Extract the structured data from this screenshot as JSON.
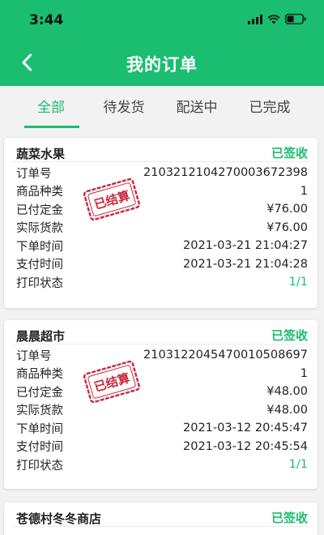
{
  "status_bar": {
    "time": "3:44"
  },
  "header": {
    "title": "我的订单"
  },
  "tabs": [
    {
      "label": "全部",
      "active": true
    },
    {
      "label": "待发货",
      "active": false
    },
    {
      "label": "配送中",
      "active": false
    },
    {
      "label": "已完成",
      "active": false
    }
  ],
  "colors": {
    "accent": "#1bbd71",
    "stamp": "#c8283e"
  },
  "orders": [
    {
      "store": "蔬菜水果",
      "status": "已签收",
      "stamp": "已结算",
      "rows": [
        {
          "label": "订单号",
          "value": "21032121042700036723​98"
        },
        {
          "label": "商品种类",
          "value": "1"
        },
        {
          "label": "已付定金",
          "value": "¥76.00"
        },
        {
          "label": "实际货款",
          "value": "¥76.00"
        },
        {
          "label": "下单时间",
          "value": "2021-03-21 21:04:27"
        },
        {
          "label": "支付时间",
          "value": "2021-03-21 21:04:28"
        },
        {
          "label": "打印状态",
          "value": "1/1"
        }
      ]
    },
    {
      "store": "晨晨超市",
      "status": "已签收",
      "stamp": "已结算",
      "rows": [
        {
          "label": "订单号",
          "value": "21031220454700105086​97"
        },
        {
          "label": "商品种类",
          "value": "1"
        },
        {
          "label": "已付定金",
          "value": "¥48.00"
        },
        {
          "label": "实际货款",
          "value": "¥48.00"
        },
        {
          "label": "下单时间",
          "value": "2021-03-12 20:45:47"
        },
        {
          "label": "支付时间",
          "value": "2021-03-12 20:45:54"
        },
        {
          "label": "打印状态",
          "value": "1/1"
        }
      ]
    },
    {
      "store": "苍德村冬冬商店",
      "status": "已签收"
    }
  ]
}
